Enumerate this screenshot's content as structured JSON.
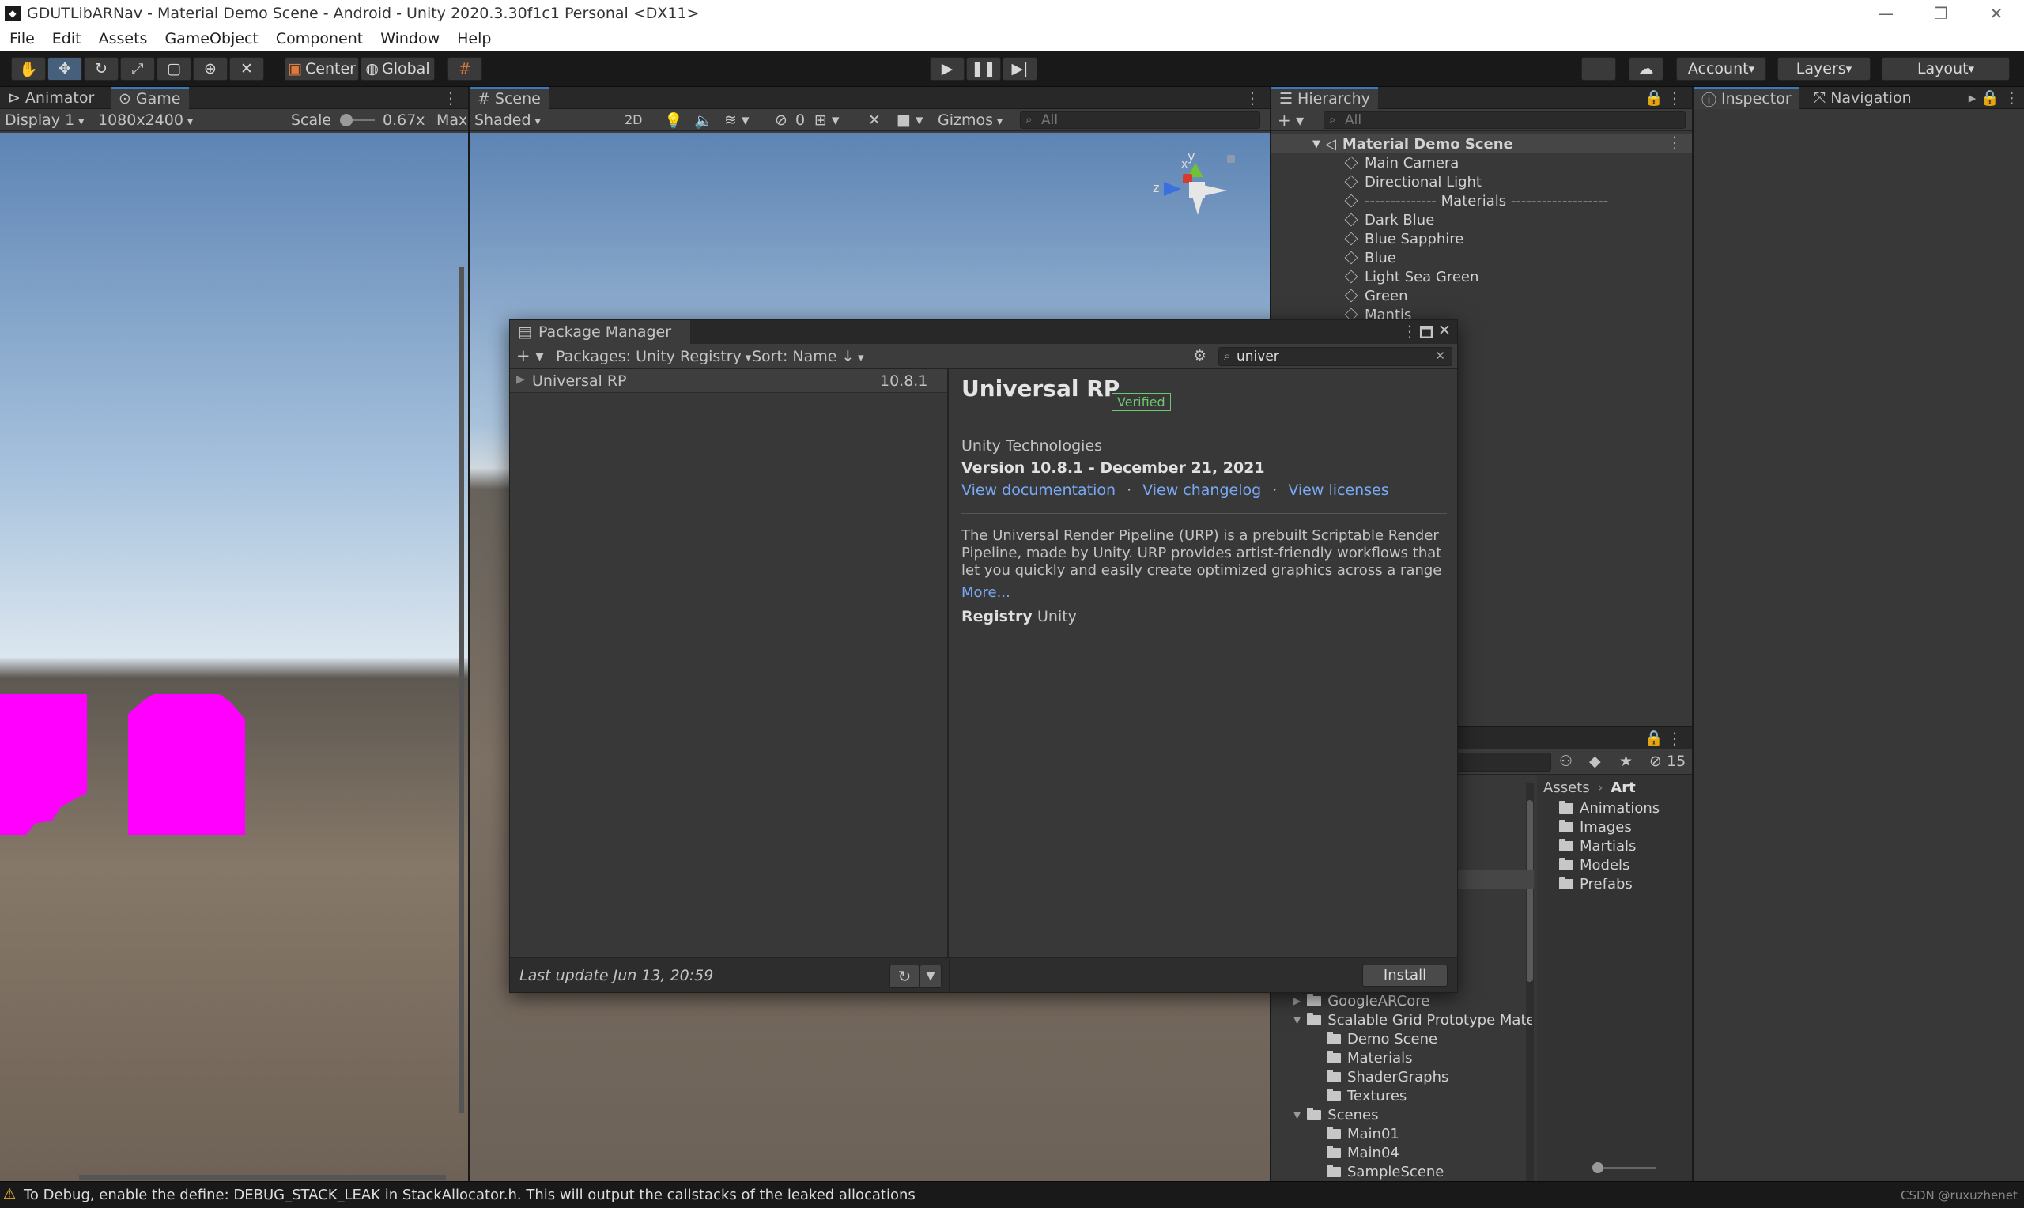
{
  "window": {
    "title": "GDUTLibARNav - Material Demo Scene - Android - Unity 2020.3.30f1c1 Personal <DX11>",
    "min": "—",
    "max": "❐",
    "close": "✕"
  },
  "menu": [
    "File",
    "Edit",
    "Assets",
    "GameObject",
    "Component",
    "Window",
    "Help"
  ],
  "toolbar": {
    "center": "Center",
    "global": "Global",
    "account": "Account",
    "layers": "Layers",
    "layout": "Layout"
  },
  "game_panel": {
    "tabs": [
      "Animator",
      "Game"
    ],
    "display": "Display 1",
    "resolution": "1080x2400",
    "scale_label": "Scale",
    "scale_value": "0.67x",
    "max": "Max"
  },
  "scene_panel": {
    "tab": "Scene",
    "shading": "Shaded",
    "mode2d": "2D",
    "hidden_count": "0",
    "gizmos": "Gizmos",
    "search_placeholder": "All",
    "gizmo_axes": {
      "x": "x",
      "y": "y",
      "z": "z"
    }
  },
  "hierarchy": {
    "tab": "Hierarchy",
    "search_placeholder": "All",
    "scene": "Material Demo Scene",
    "items": [
      "Main Camera",
      "Directional Light",
      "-------------- Materials -------------------",
      "Dark Blue",
      "Blue Sapphire",
      "Blue",
      "Light Sea Green",
      "Green",
      "Mantis"
    ]
  },
  "inspector": {
    "tabs": [
      "Inspector",
      "Navigation"
    ]
  },
  "package_manager": {
    "title": "Package Manager",
    "source": "Packages: Unity Registry",
    "sort": "Sort: Name ↓",
    "search_value": "univer",
    "list": [
      {
        "name": "Universal RP",
        "version": "10.8.1"
      }
    ],
    "detail": {
      "name": "Universal RP",
      "badge": "Verified",
      "author": "Unity Technologies",
      "version": "Version 10.8.1 - December 21, 2021",
      "links": [
        "View documentation",
        "View changelog",
        "View licenses"
      ],
      "description": "The Universal Render Pipeline (URP) is a prebuilt Scriptable Render Pipeline, made by Unity. URP provides artist-friendly workflows that let you quickly and easily create optimized graphics across a range",
      "more": "More...",
      "registry_label": "Registry",
      "registry_value": "Unity"
    },
    "last_update": "Last update Jun 13, 20:59",
    "install": "Install"
  },
  "project": {
    "hidden_count": "15",
    "breadcrumb": [
      "Assets",
      "Art"
    ],
    "folders": [
      "Animations",
      "Images",
      "Martials",
      "Models",
      "Prefabs"
    ],
    "tree": [
      {
        "label": "GoogleARCore",
        "depth": 0,
        "arrow": "▶"
      },
      {
        "label": "Scalable Grid Prototype Mate",
        "depth": 0,
        "arrow": "▼"
      },
      {
        "label": "Demo Scene",
        "depth": 1,
        "arrow": ""
      },
      {
        "label": "Materials",
        "depth": 1,
        "arrow": ""
      },
      {
        "label": "ShaderGraphs",
        "depth": 1,
        "arrow": ""
      },
      {
        "label": "Textures",
        "depth": 1,
        "arrow": ""
      },
      {
        "label": "Scenes",
        "depth": 0,
        "arrow": "▼"
      },
      {
        "label": "Main01",
        "depth": 1,
        "arrow": ""
      },
      {
        "label": "Main04",
        "depth": 1,
        "arrow": ""
      },
      {
        "label": "SampleScene",
        "depth": 1,
        "arrow": ""
      }
    ]
  },
  "status": {
    "message": "To Debug, enable the define: DEBUG_STACK_LEAK in StackAllocator.h. This will output the callstacks of the leaked allocations",
    "watermark": "CSDN @ruxuzhenet"
  },
  "colors": {
    "accent": "#3a79bb",
    "magenta": "#ff00ff",
    "verified": "#6fc66f"
  }
}
